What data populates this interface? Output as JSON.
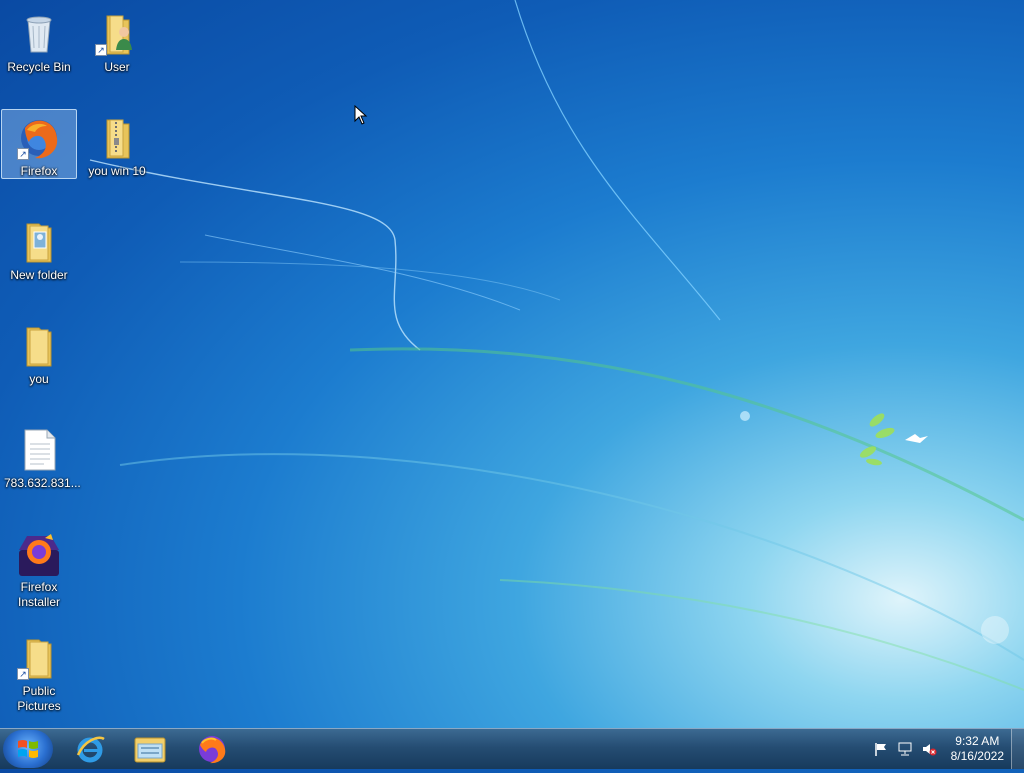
{
  "desktop": {
    "icons": [
      {
        "label": "Recycle Bin",
        "icon": "recycle-bin-icon"
      },
      {
        "label": "User",
        "icon": "user-folder-icon"
      },
      {
        "label": "Firefox",
        "icon": "firefox-icon",
        "selected": true
      },
      {
        "label": "you win 10",
        "icon": "zip-folder-icon"
      },
      {
        "label": "New folder",
        "icon": "folder-icon"
      },
      {
        "label": "you",
        "icon": "folder-icon"
      },
      {
        "label": "783.632.831...",
        "icon": "text-file-icon"
      },
      {
        "label": "Firefox Installer",
        "icon": "firefox-installer-icon"
      },
      {
        "label": "Public Pictures",
        "icon": "pictures-folder-icon"
      }
    ]
  },
  "taskbar": {
    "pinned": [
      {
        "name": "Internet Explorer",
        "icon": "internet-explorer-icon"
      },
      {
        "name": "Windows Explorer",
        "icon": "file-explorer-icon"
      },
      {
        "name": "Firefox",
        "icon": "firefox-icon"
      }
    ],
    "tray_icons": [
      "action-center-flag-icon",
      "network-icon",
      "volume-muted-icon"
    ],
    "clock": {
      "time": "9:32 AM",
      "date": "8/16/2022"
    }
  },
  "colors": {
    "accent": "#1c7ccf",
    "taskbar": "#254d73",
    "folder": "#f2cf6b"
  }
}
